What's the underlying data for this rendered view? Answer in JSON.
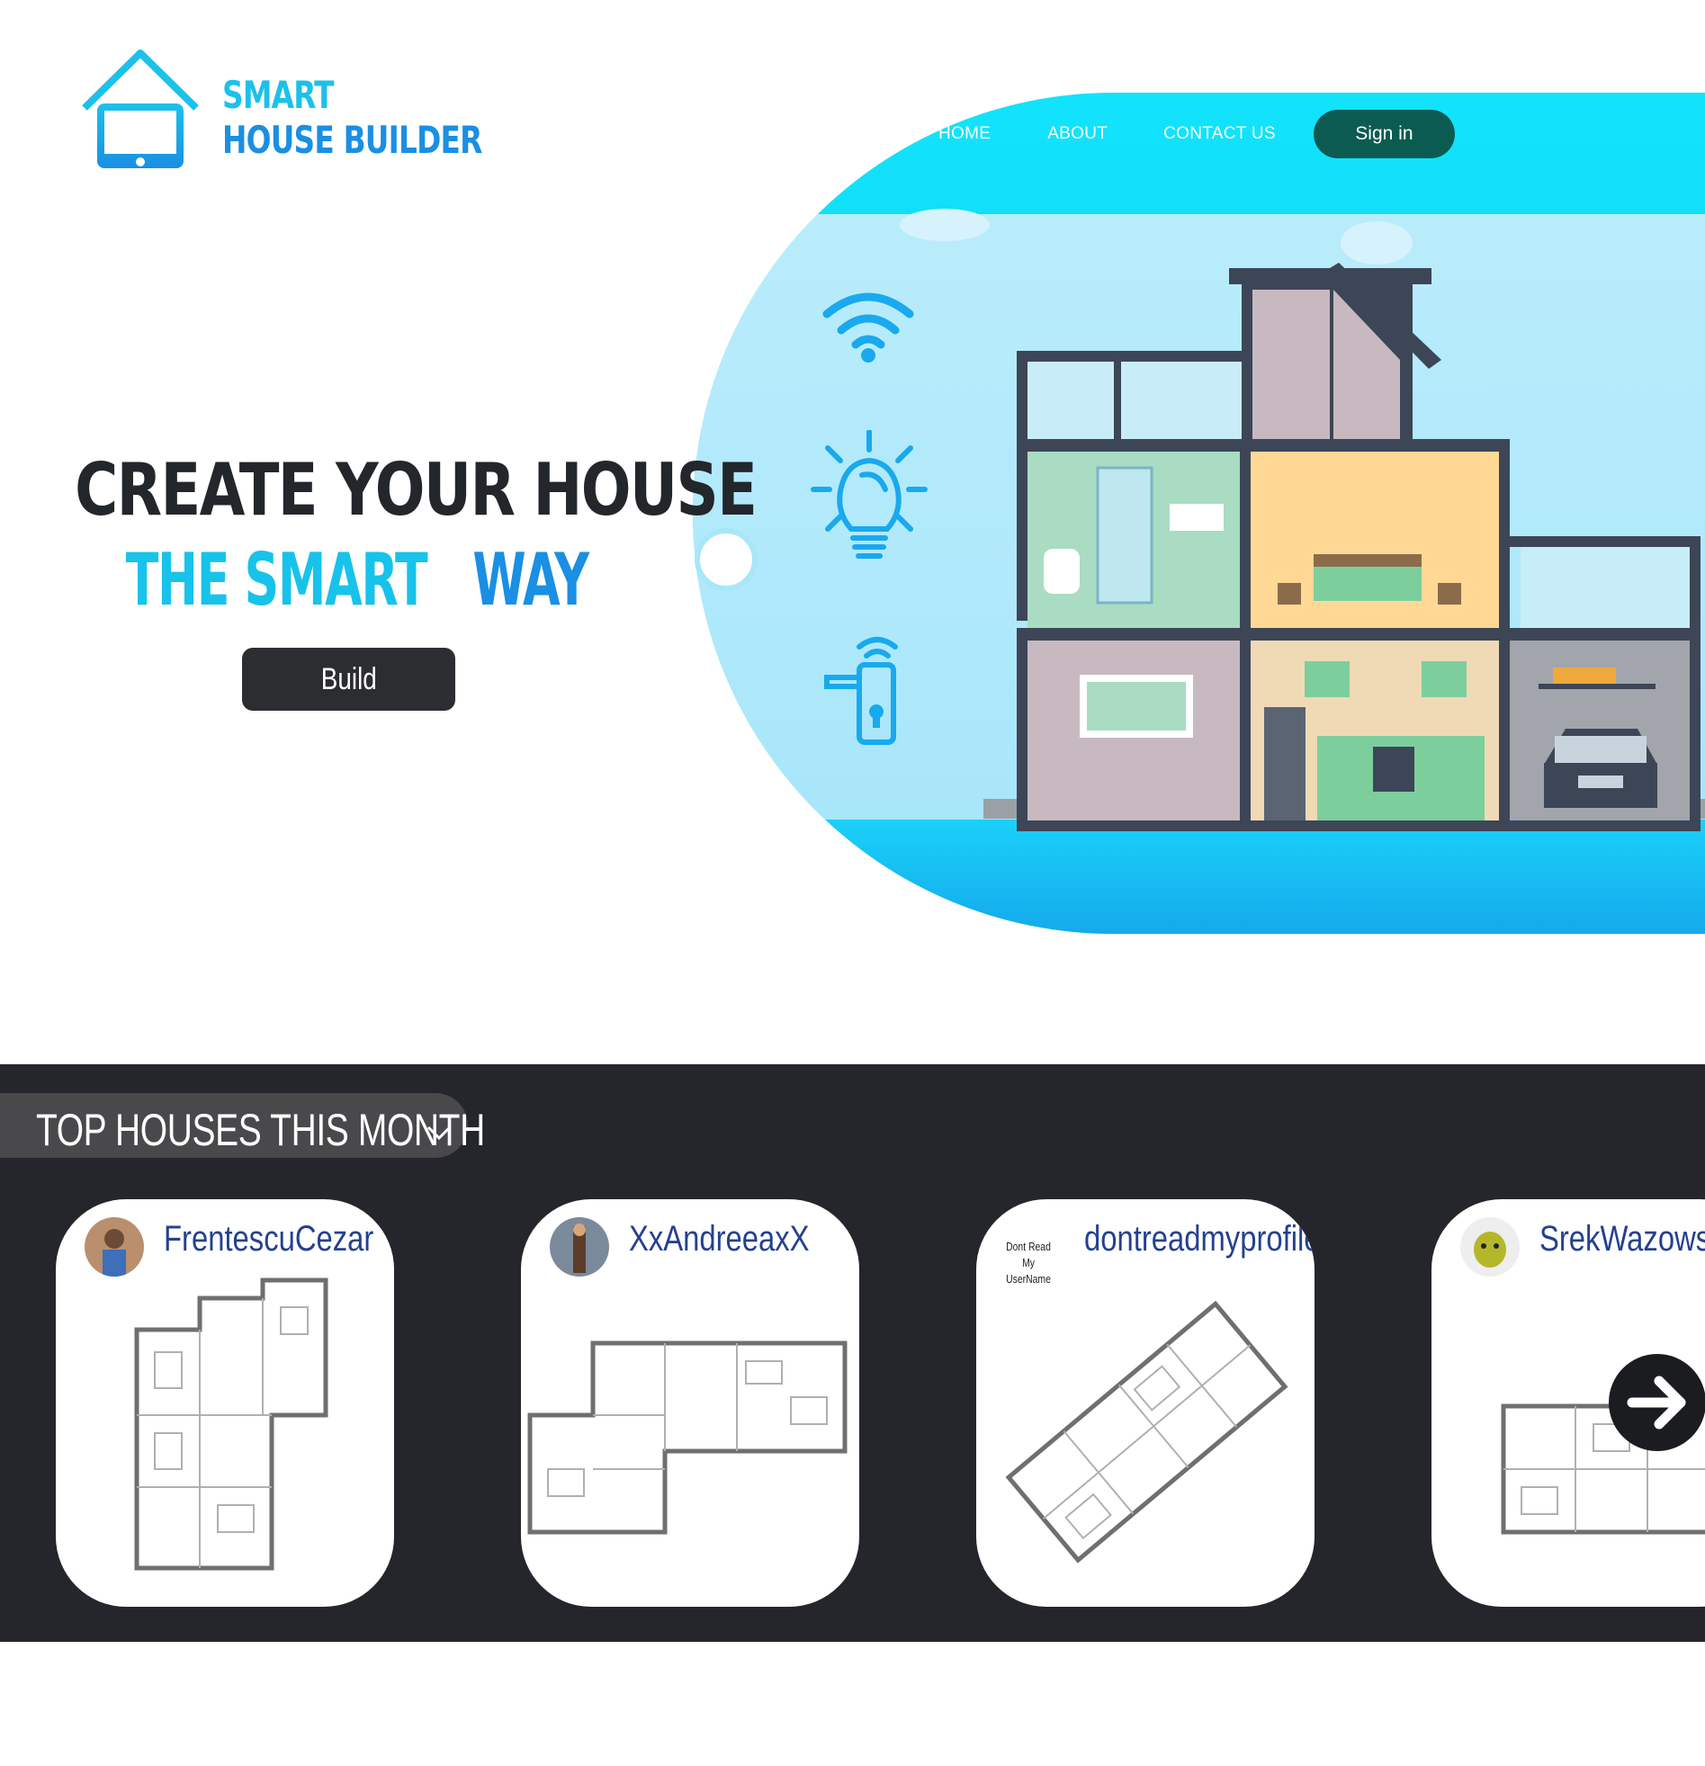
{
  "brand": {
    "line1": "SMART",
    "line2": "HOUSE BUILDER",
    "icon": "house-tablet-icon"
  },
  "nav": {
    "home": "HOME",
    "about": "ABOUT",
    "contact": "CONTACT US",
    "signin": "Sign in"
  },
  "hero": {
    "line1": "CREATE YOUR HOUSE",
    "line2_part1": "THE SMART ",
    "line2_part2": "WAY",
    "build_label": "Build",
    "features": [
      "wifi-icon",
      "lightbulb-icon",
      "smart-lock-icon"
    ]
  },
  "top_houses": {
    "title": "TOP HOUSES THIS MONTH",
    "cards": [
      {
        "username": "FrentescuCezar"
      },
      {
        "username": "XxAndreeaxX"
      },
      {
        "username": "dontreadmyprofile",
        "avatar_text": "Dont Read My UserName"
      },
      {
        "username": "SrekWazowski"
      }
    ]
  },
  "colors": {
    "accent_light": "#17c3ea",
    "accent_dark": "#1a8fe3",
    "signin_bg": "#0c5b52",
    "section_bg": "#24262b"
  }
}
